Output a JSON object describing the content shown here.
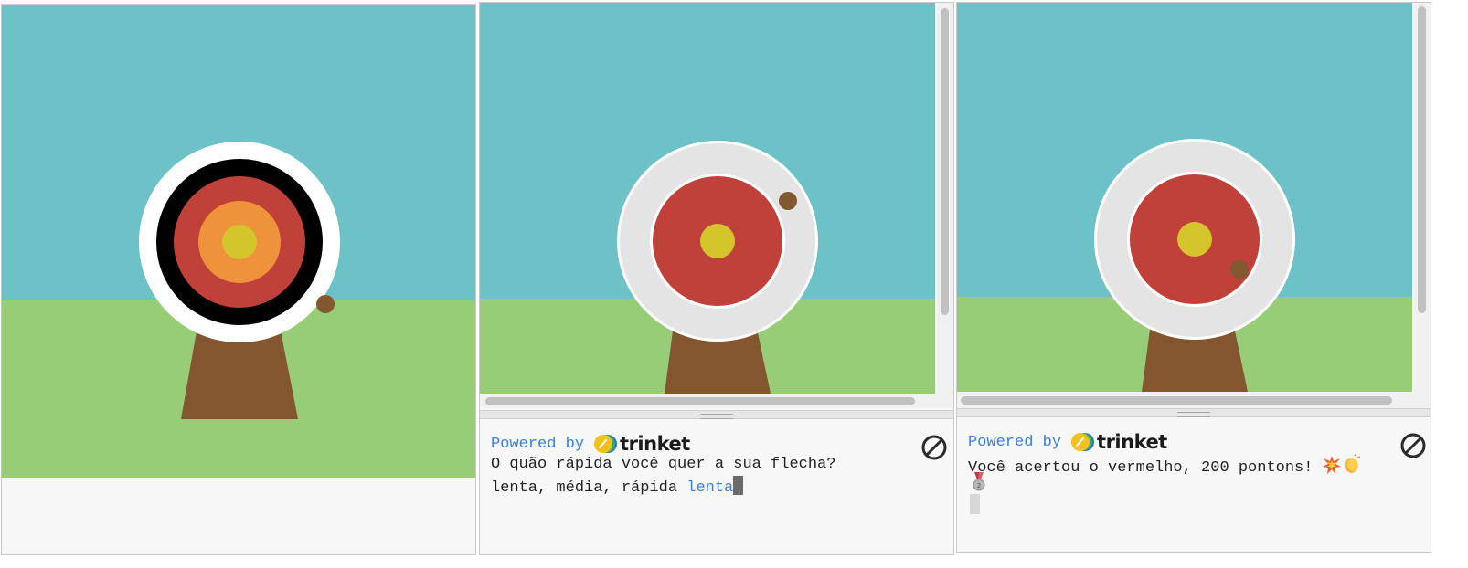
{
  "colors": {
    "sky": "#6cc2c7",
    "grass": "#98cd78",
    "stand": "#83562f",
    "arrow": "#81582f",
    "link_blue": "#3b7fdc",
    "panel_bg": "#f7f7f7"
  },
  "panels": [
    {
      "name": "scene-panel-1",
      "target_rings": [
        "white",
        "black",
        "red",
        "orange",
        "yellow"
      ]
    },
    {
      "name": "scene-panel-2",
      "target_rings": [
        "light-gray",
        "red",
        "yellow"
      ],
      "console": {
        "powered_by_label": "Powered by",
        "brand": "trinket",
        "prompt_line_1": "O quão rápida você quer a sua flecha?",
        "prompt_line_2": "lenta, média, rápida ",
        "user_input": "lenta"
      }
    },
    {
      "name": "scene-panel-3",
      "target_rings": [
        "light-gray",
        "red",
        "yellow"
      ],
      "console": {
        "powered_by_label": "Powered by",
        "brand": "trinket",
        "result_line": "Você acertou o vermelho, 200 pontons!",
        "emoji_icons": [
          "collision-icon",
          "clapping-hands-icon",
          "medal-icon"
        ]
      }
    }
  ],
  "icons": {
    "stop": "stop-circle-slash-icon",
    "logo": "trinket-logo-icon"
  }
}
